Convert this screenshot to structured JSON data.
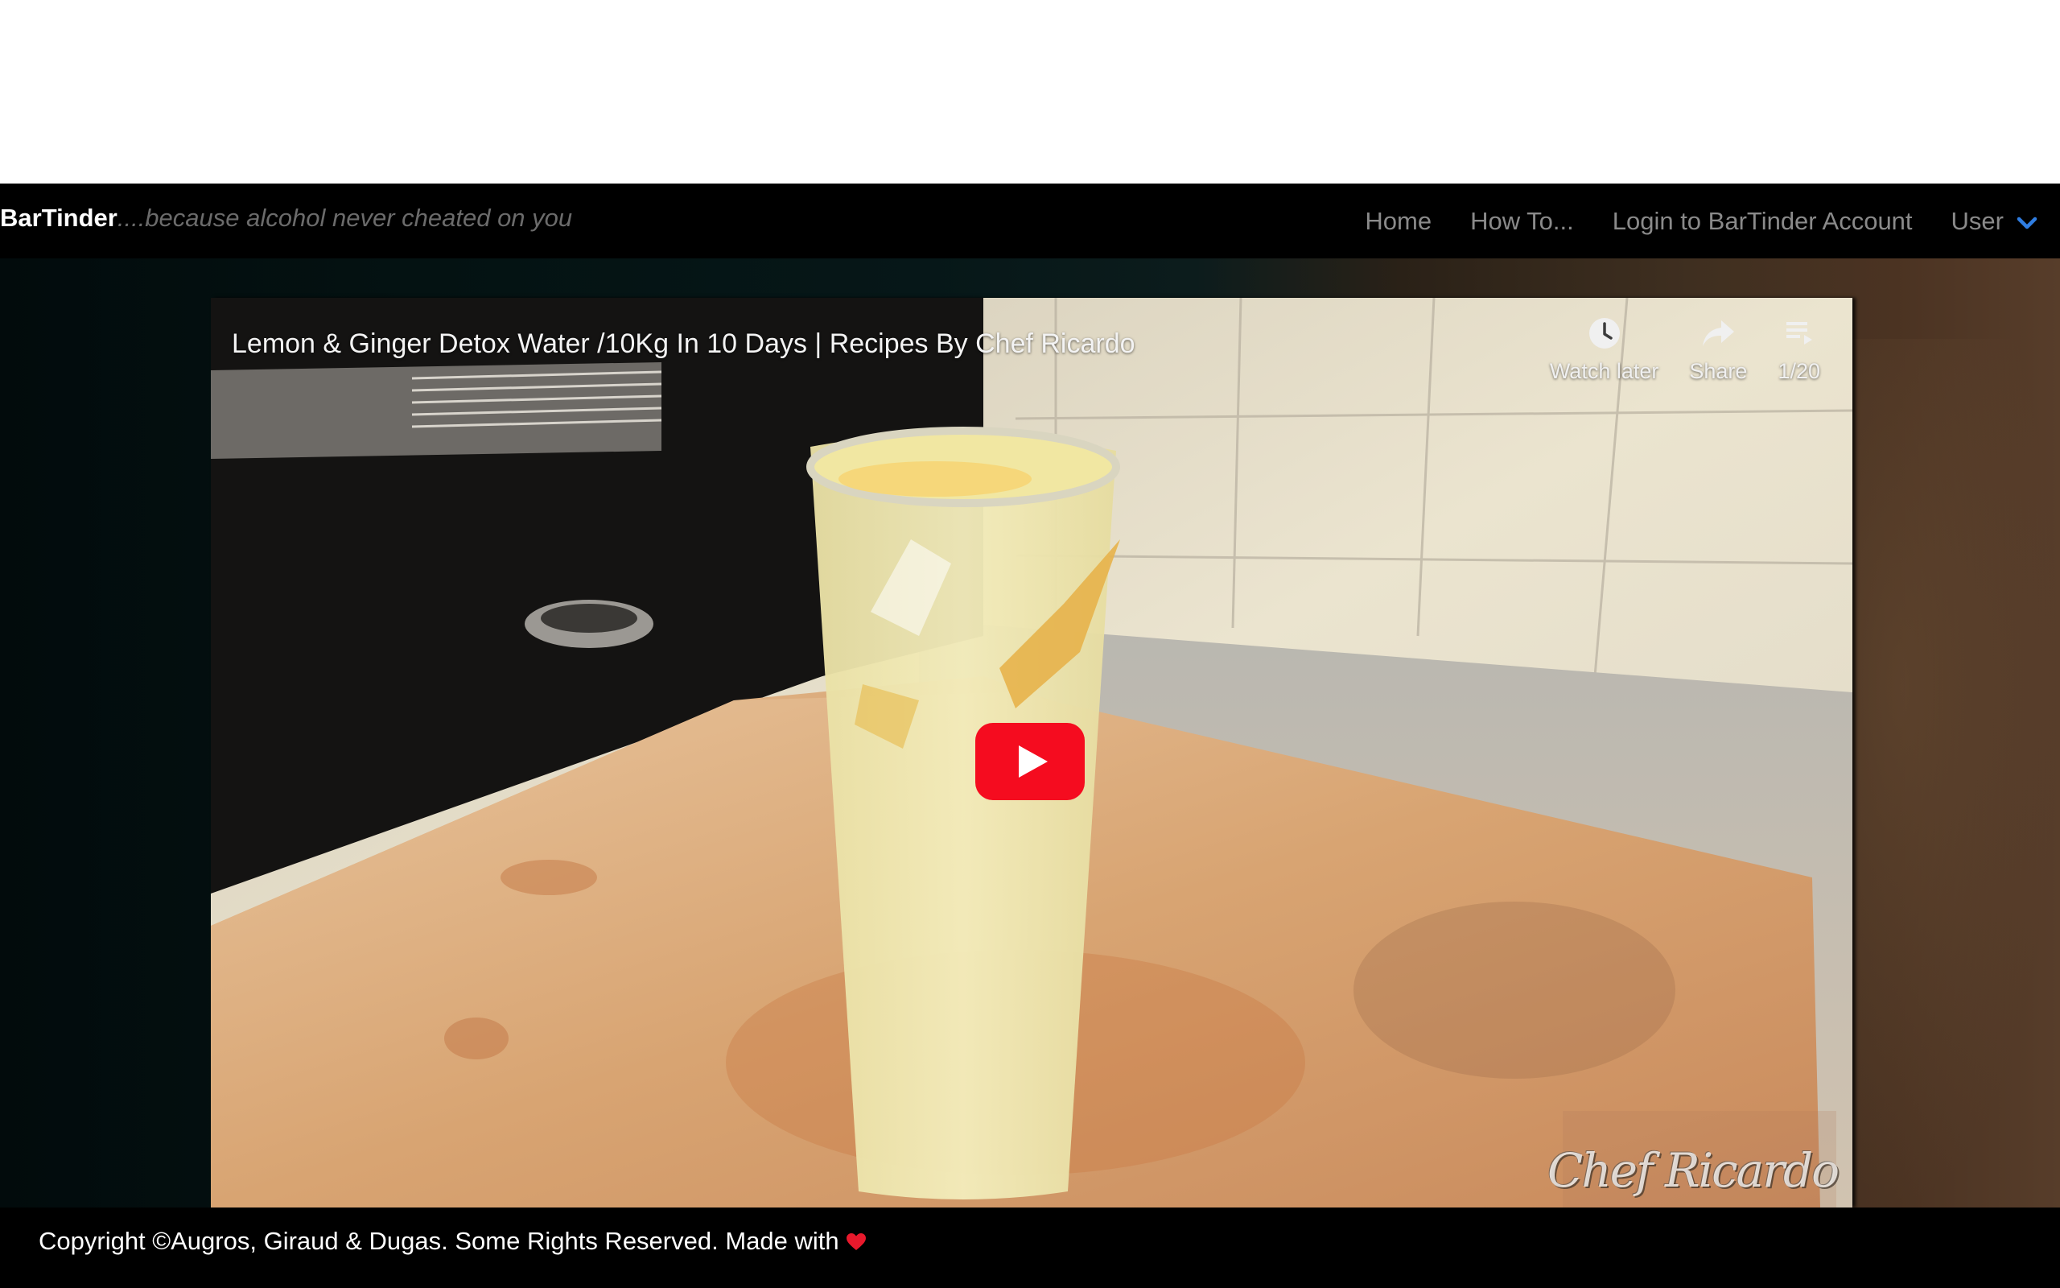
{
  "brand": {
    "name": "BarTinder",
    "tagline": "....because alcohol never cheated on you"
  },
  "nav": {
    "items": [
      {
        "label": "Home"
      },
      {
        "label": "How To..."
      },
      {
        "label": "Login to BarTinder Account"
      }
    ],
    "user": {
      "label": "User",
      "icon": "chevron-down-icon"
    }
  },
  "video": {
    "title": "Lemon & Ginger Detox Water /10Kg In 10 Days | Recipes By Chef Ricardo",
    "controls": {
      "watch_later": {
        "label": "Watch later",
        "icon": "clock-icon"
      },
      "share": {
        "label": "Share",
        "icon": "share-icon"
      },
      "playlist": {
        "label": "1/20",
        "icon": "playlist-icon"
      }
    },
    "play_icon": "youtube-play-icon",
    "watermark": "Chef Ricardo"
  },
  "footer": {
    "text": "Copyright ©Augros, Giraud & Dugas. Some Rights Reserved. Made with",
    "icon": "heart-icon"
  },
  "colors": {
    "navbar_bg": "#000000",
    "nav_link": "#8a8a8a",
    "accent_chevron": "#2f7de1",
    "youtube_red": "#f50c1f",
    "heart": "#e8192c"
  }
}
